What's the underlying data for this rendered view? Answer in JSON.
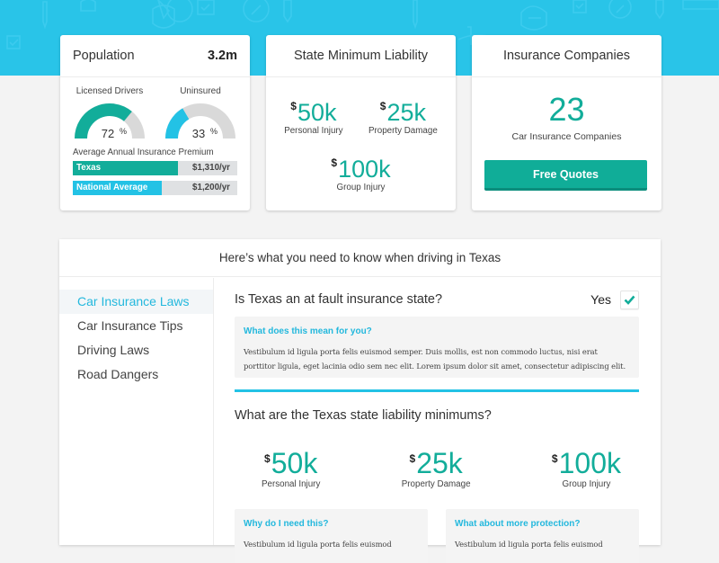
{
  "colors": {
    "hero": "#29c4e8",
    "teal": "#12ad9a",
    "blue": "#23c2e5",
    "track": "#d9d9d9"
  },
  "population": {
    "title": "Population",
    "value": "3.2m",
    "licensed": {
      "label": "Licensed Drivers",
      "percent": 72,
      "display": "72",
      "sign": "%"
    },
    "uninsured": {
      "label": "Uninsured",
      "percent": 33,
      "display": "33",
      "sign": "%"
    },
    "premium_title": "Average Annual Insurance Premium",
    "premiums": [
      {
        "name": "Texas",
        "amount": "$1,310/yr",
        "fill_fraction": 0.64
      },
      {
        "name": "National Average",
        "amount": "$1,200/yr",
        "fill_fraction": 0.54
      }
    ]
  },
  "liability": {
    "title": "State Minimum Liability",
    "items": [
      {
        "dollar": "$",
        "value": "50k",
        "label": "Personal Injury"
      },
      {
        "dollar": "$",
        "value": "25k",
        "label": "Property Damage"
      },
      {
        "dollar": "$",
        "value": "100k",
        "label": "Group Injury"
      }
    ]
  },
  "companies": {
    "title": "Insurance Companies",
    "count": "23",
    "caption": "Car Insurance Companies",
    "button": "Free Quotes"
  },
  "panel": {
    "title": "Here’s what you need to know when driving in Texas",
    "sidebar": [
      {
        "label": "Car Insurance Laws",
        "active": true
      },
      {
        "label": "Car Insurance Tips",
        "active": false
      },
      {
        "label": "Driving Laws",
        "active": false
      },
      {
        "label": "Road Dangers",
        "active": false
      }
    ],
    "q1": {
      "question": "Is Texas an at fault insurance state?",
      "answer": "Yes",
      "checked": true,
      "note_title": "What does this mean for you?",
      "note_body": "Vestibulum id ligula porta felis euismod semper. Duis mollis, est non commodo luctus, nisi erat porttitor ligula, eget lacinia odio sem nec elit. Lorem ipsum dolor sit amet, consectetur adipiscing elit."
    },
    "q2": {
      "question": "What are the Texas state liability minimums?",
      "items": [
        {
          "dollar": "$",
          "value": "50k",
          "label": "Personal Injury"
        },
        {
          "dollar": "$",
          "value": "25k",
          "label": "Property Damage"
        },
        {
          "dollar": "$",
          "value": "100k",
          "label": "Group Injury"
        }
      ],
      "notes": [
        {
          "title": "Why do I need this?",
          "body": "Vestibulum id ligula porta felis euismod"
        },
        {
          "title": "What about more protection?",
          "body": "Vestibulum id ligula porta felis euismod"
        }
      ]
    }
  }
}
